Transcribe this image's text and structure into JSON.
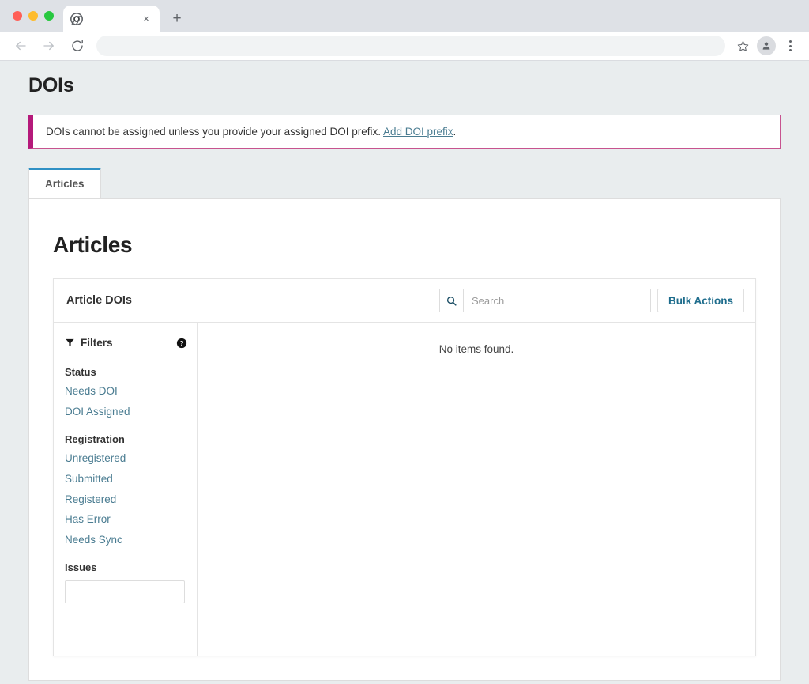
{
  "browser": {
    "tab": {
      "title": "",
      "favicon_name": "chrome-favicon",
      "close_label": "×"
    },
    "new_tab_label": "+",
    "address_value": "",
    "address_placeholder": "",
    "back_label": "Back",
    "forward_label": "Forward",
    "reload_label": "Reload",
    "bookmark_label": "Bookmark this tab",
    "profile_label": "Profile",
    "menu_label": "Customize and control"
  },
  "page": {
    "title": "DOIs",
    "notice": {
      "text_before": "DOIs cannot be assigned unless you provide your assigned DOI prefix.",
      "link_text": "Add DOI prefix",
      "text_after": ".",
      "accent_color": "#b5197a",
      "border_color": "#c7538f"
    },
    "tabs": [
      {
        "label": "Articles",
        "active": true
      }
    ],
    "section_title": "Articles",
    "card": {
      "title": "Article DOIs",
      "search": {
        "placeholder": "Search",
        "value": "",
        "icon_name": "search-icon"
      },
      "bulk_actions_label": "Bulk Actions",
      "filters": {
        "heading": "Filters",
        "filter_icon_name": "funnel-icon",
        "help_icon_name": "help-circle-icon",
        "groups": [
          {
            "title": "Status",
            "items": [
              "Needs DOI",
              "DOI Assigned"
            ]
          },
          {
            "title": "Registration",
            "items": [
              "Unregistered",
              "Submitted",
              "Registered",
              "Has Error",
              "Needs Sync"
            ]
          }
        ],
        "issues": {
          "title": "Issues",
          "value": "",
          "placeholder": ""
        }
      },
      "empty_message": "No items found."
    }
  },
  "colors": {
    "link": "#4a7c91",
    "accent_tab": "#2f90c4",
    "bulk_action": "#1d6c8c",
    "notice_accent": "#b5197a",
    "page_bg": "#e9edee"
  }
}
